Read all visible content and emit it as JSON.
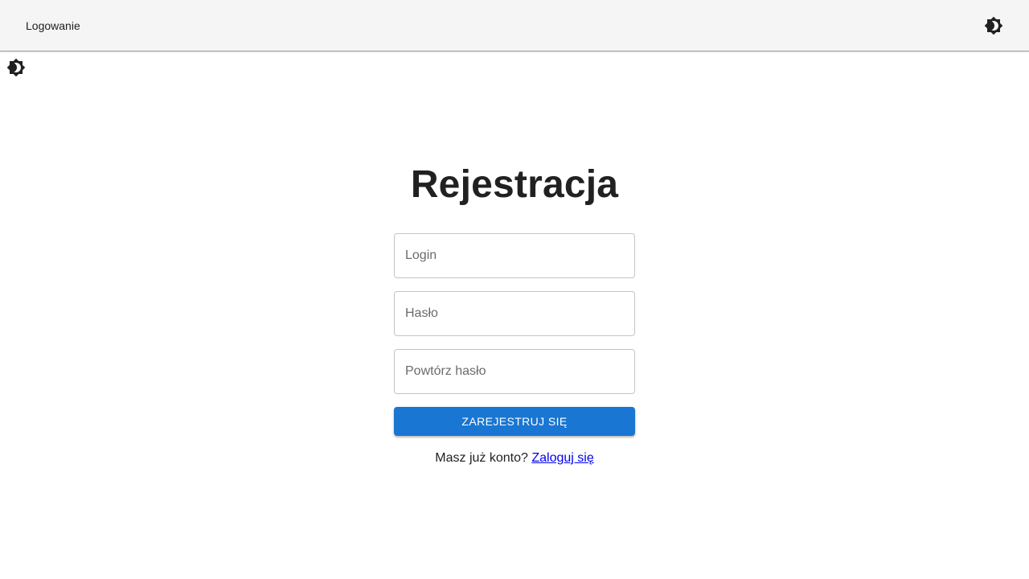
{
  "topbar": {
    "nav_label": "Logowanie",
    "theme_toggle_icon": "brightness-icon"
  },
  "side_theme_toggle_icon": "brightness-icon",
  "register": {
    "title": "Rejestracja",
    "login": {
      "placeholder": "Login",
      "value": ""
    },
    "password": {
      "placeholder": "Hasło",
      "value": ""
    },
    "repeat_password": {
      "placeholder": "Powtórz hasło",
      "value": ""
    },
    "submit_label": "ZAREJESTRUJ SIĘ",
    "footer_text": "Masz już konto?",
    "footer_link": "Zaloguj się"
  },
  "colors": {
    "accent": "#1976d2",
    "topbar_bg": "#f5f5f5",
    "link": "#0000ee"
  }
}
